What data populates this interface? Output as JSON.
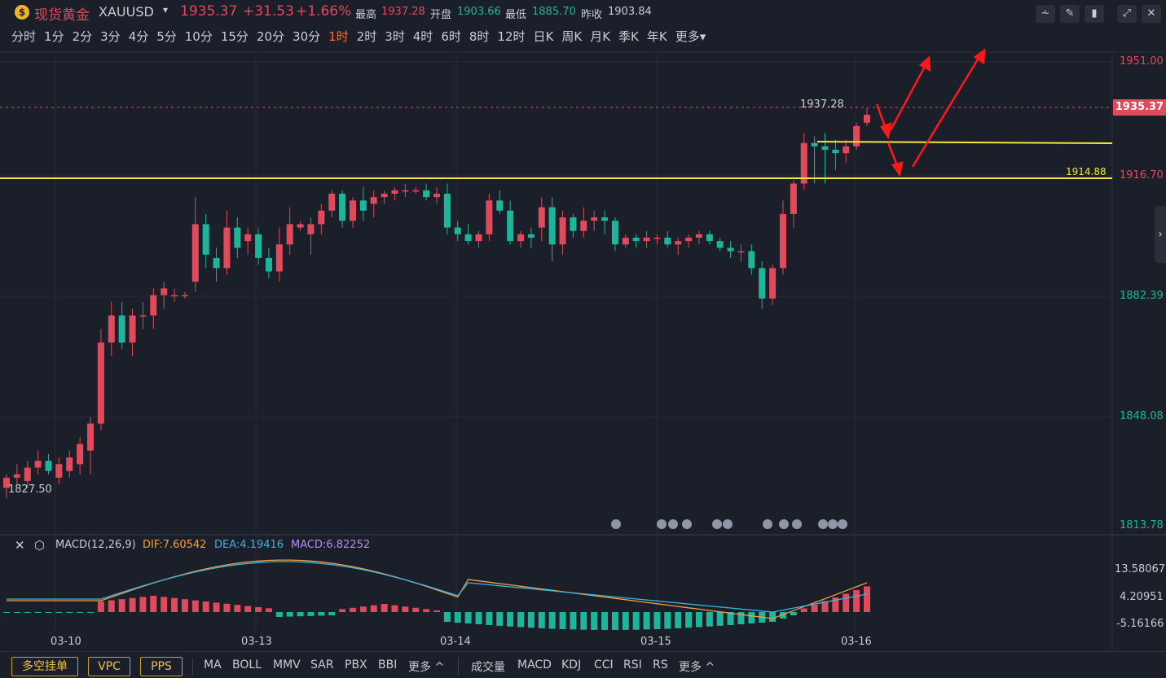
{
  "header": {
    "title": "现货黄金",
    "symbol": "XAUUSD",
    "price": "1935.37",
    "change": "+31.53",
    "change_pct": "+1.66%",
    "high_label": "最高",
    "high": "1937.28",
    "open_label": "开盘",
    "open": "1903.66",
    "low_label": "最低",
    "low": "1885.70",
    "prev_label": "昨收",
    "prev": "1903.84"
  },
  "periods": [
    "分时",
    "1分",
    "2分",
    "3分",
    "4分",
    "5分",
    "10分",
    "15分",
    "20分",
    "30分",
    "1时",
    "2时",
    "3时",
    "4时",
    "6时",
    "8时",
    "12时",
    "日K",
    "周K",
    "月K",
    "季K",
    "年K",
    "更多"
  ],
  "active_period": "1时",
  "colors": {
    "up": "#e04a5a",
    "down": "#1fb59a",
    "bg": "#1b1f2a",
    "line": "#f5e63a",
    "arrow": "#ff1a1a",
    "dif": "#f0a040",
    "dea": "#3ab4e0",
    "macd": "#b98cf0"
  },
  "y_axis": {
    "labels": [
      "1951.00",
      "1916.70",
      "1882.39",
      "1848.08",
      "1813.78"
    ],
    "current_price_tag": "1935.37",
    "line_level_tag": "1914.88"
  },
  "annotations": {
    "high_label": "1937.28",
    "low_label": "1827.50"
  },
  "dates": [
    "03-10",
    "03-13",
    "03-14",
    "03-15",
    "03-16"
  ],
  "macd": {
    "title": "MACD(12,26,9)",
    "dif": "DIF:7.60542",
    "dea": "DEA:4.19416",
    "macd": "MACD:6.82252",
    "labels": [
      "13.58067",
      "4.20951",
      "-5.16166"
    ]
  },
  "bottom": {
    "buttons": [
      "多空挂单",
      "VPC",
      "PPS"
    ],
    "indicators": [
      "MA",
      "BOLL",
      "MMV",
      "SAR",
      "PBX",
      "BBI",
      "更多 ^"
    ],
    "sub_indicators": [
      "成交量",
      "MACD",
      "KDJ",
      "CCI",
      "RSI",
      "RS",
      "更多 ^"
    ]
  },
  "chart_data": {
    "type": "candlestick",
    "series": [
      {
        "o": 1825,
        "h": 1829,
        "l": 1822,
        "c": 1828
      },
      {
        "o": 1828,
        "h": 1832,
        "l": 1826,
        "c": 1829
      },
      {
        "o": 1827,
        "h": 1833,
        "l": 1825,
        "c": 1831
      },
      {
        "o": 1831,
        "h": 1836,
        "l": 1829,
        "c": 1833
      },
      {
        "o": 1833,
        "h": 1835,
        "l": 1829,
        "c": 1830
      },
      {
        "o": 1828,
        "h": 1834,
        "l": 1826,
        "c": 1832
      },
      {
        "o": 1830,
        "h": 1836,
        "l": 1828,
        "c": 1834
      },
      {
        "o": 1832,
        "h": 1840,
        "l": 1829,
        "c": 1838
      },
      {
        "o": 1836,
        "h": 1846,
        "l": 1829,
        "c": 1844
      },
      {
        "o": 1844,
        "h": 1872,
        "l": 1842,
        "c": 1868
      },
      {
        "o": 1868,
        "h": 1880,
        "l": 1864,
        "c": 1876
      },
      {
        "o": 1876,
        "h": 1880,
        "l": 1866,
        "c": 1868
      },
      {
        "o": 1868,
        "h": 1878,
        "l": 1864,
        "c": 1876
      },
      {
        "o": 1876,
        "h": 1880,
        "l": 1872,
        "c": 1876
      },
      {
        "o": 1876,
        "h": 1884,
        "l": 1872,
        "c": 1882
      },
      {
        "o": 1882,
        "h": 1886,
        "l": 1878,
        "c": 1884
      },
      {
        "o": 1882,
        "h": 1884,
        "l": 1880,
        "c": 1882
      },
      {
        "o": 1882,
        "h": 1883,
        "l": 1881,
        "c": 1882
      },
      {
        "o": 1886,
        "h": 1911,
        "l": 1883,
        "c": 1903
      },
      {
        "o": 1903,
        "h": 1906,
        "l": 1890,
        "c": 1894
      },
      {
        "o": 1893,
        "h": 1896,
        "l": 1886,
        "c": 1890
      },
      {
        "o": 1890,
        "h": 1907,
        "l": 1888,
        "c": 1902
      },
      {
        "o": 1902,
        "h": 1905,
        "l": 1893,
        "c": 1896
      },
      {
        "o": 1898,
        "h": 1902,
        "l": 1894,
        "c": 1900
      },
      {
        "o": 1900,
        "h": 1902,
        "l": 1891,
        "c": 1893
      },
      {
        "o": 1893,
        "h": 1896,
        "l": 1887,
        "c": 1889
      },
      {
        "o": 1889,
        "h": 1902,
        "l": 1886,
        "c": 1897
      },
      {
        "o": 1897,
        "h": 1908,
        "l": 1894,
        "c": 1903
      },
      {
        "o": 1902,
        "h": 1904,
        "l": 1901,
        "c": 1903
      },
      {
        "o": 1900,
        "h": 1905,
        "l": 1894,
        "c": 1903
      },
      {
        "o": 1903,
        "h": 1909,
        "l": 1900,
        "c": 1907
      },
      {
        "o": 1907,
        "h": 1913,
        "l": 1905,
        "c": 1912
      },
      {
        "o": 1912,
        "h": 1913,
        "l": 1902,
        "c": 1904
      },
      {
        "o": 1904,
        "h": 1911,
        "l": 1902,
        "c": 1910
      },
      {
        "o": 1910,
        "h": 1914,
        "l": 1904,
        "c": 1907
      },
      {
        "o": 1909,
        "h": 1913,
        "l": 1905,
        "c": 1911
      },
      {
        "o": 1911,
        "h": 1913,
        "l": 1909,
        "c": 1912
      },
      {
        "o": 1912,
        "h": 1914,
        "l": 1910,
        "c": 1913
      },
      {
        "o": 1913,
        "h": 1915,
        "l": 1911,
        "c": 1913
      },
      {
        "o": 1913,
        "h": 1914,
        "l": 1912,
        "c": 1913
      },
      {
        "o": 1913,
        "h": 1915,
        "l": 1910,
        "c": 1911
      },
      {
        "o": 1911,
        "h": 1914,
        "l": 1909,
        "c": 1912
      },
      {
        "o": 1912,
        "h": 1915,
        "l": 1900,
        "c": 1902
      },
      {
        "o": 1902,
        "h": 1904,
        "l": 1898,
        "c": 1900
      },
      {
        "o": 1900,
        "h": 1903,
        "l": 1897,
        "c": 1898
      },
      {
        "o": 1898,
        "h": 1901,
        "l": 1896,
        "c": 1900
      },
      {
        "o": 1900,
        "h": 1912,
        "l": 1898,
        "c": 1910
      },
      {
        "o": 1910,
        "h": 1913,
        "l": 1906,
        "c": 1907
      },
      {
        "o": 1907,
        "h": 1910,
        "l": 1897,
        "c": 1898
      },
      {
        "o": 1898,
        "h": 1901,
        "l": 1896,
        "c": 1900
      },
      {
        "o": 1900,
        "h": 1902,
        "l": 1896,
        "c": 1899
      },
      {
        "o": 1902,
        "h": 1911,
        "l": 1898,
        "c": 1908
      },
      {
        "o": 1908,
        "h": 1911,
        "l": 1892,
        "c": 1897
      },
      {
        "o": 1897,
        "h": 1907,
        "l": 1894,
        "c": 1905
      },
      {
        "o": 1905,
        "h": 1906,
        "l": 1899,
        "c": 1901
      },
      {
        "o": 1901,
        "h": 1908,
        "l": 1899,
        "c": 1904
      },
      {
        "o": 1904,
        "h": 1907,
        "l": 1901,
        "c": 1905
      },
      {
        "o": 1905,
        "h": 1907,
        "l": 1900,
        "c": 1904
      },
      {
        "o": 1904,
        "h": 1905,
        "l": 1895,
        "c": 1897
      },
      {
        "o": 1897,
        "h": 1900,
        "l": 1896,
        "c": 1899
      },
      {
        "o": 1899,
        "h": 1900,
        "l": 1896,
        "c": 1898
      },
      {
        "o": 1898,
        "h": 1901,
        "l": 1896,
        "c": 1899
      },
      {
        "o": 1899,
        "h": 1900,
        "l": 1897,
        "c": 1899
      },
      {
        "o": 1899,
        "h": 1901,
        "l": 1896,
        "c": 1897
      },
      {
        "o": 1897,
        "h": 1899,
        "l": 1894,
        "c": 1898
      },
      {
        "o": 1898,
        "h": 1900,
        "l": 1896,
        "c": 1899
      },
      {
        "o": 1899,
        "h": 1901,
        "l": 1897,
        "c": 1900
      },
      {
        "o": 1900,
        "h": 1901,
        "l": 1897,
        "c": 1898
      },
      {
        "o": 1898,
        "h": 1899,
        "l": 1895,
        "c": 1896
      },
      {
        "o": 1896,
        "h": 1898,
        "l": 1893,
        "c": 1895
      },
      {
        "o": 1895,
        "h": 1897,
        "l": 1892,
        "c": 1895
      },
      {
        "o": 1895,
        "h": 1897,
        "l": 1888,
        "c": 1890
      },
      {
        "o": 1890,
        "h": 1892,
        "l": 1878,
        "c": 1881
      },
      {
        "o": 1881,
        "h": 1891,
        "l": 1879,
        "c": 1890
      },
      {
        "o": 1890,
        "h": 1910,
        "l": 1888,
        "c": 1906
      },
      {
        "o": 1906,
        "h": 1916,
        "l": 1902,
        "c": 1915
      },
      {
        "o": 1915,
        "h": 1930,
        "l": 1913,
        "c": 1927
      },
      {
        "o": 1927,
        "h": 1929,
        "l": 1915,
        "c": 1926
      },
      {
        "o": 1926,
        "h": 1930,
        "l": 1915,
        "c": 1925
      },
      {
        "o": 1925,
        "h": 1928,
        "l": 1919,
        "c": 1924
      },
      {
        "o": 1924,
        "h": 1928,
        "l": 1921,
        "c": 1926
      },
      {
        "o": 1926,
        "h": 1933,
        "l": 1925,
        "c": 1932
      },
      {
        "o": 1933,
        "h": 1937.28,
        "l": 1932,
        "c": 1935.37
      }
    ],
    "ylim": [
      1813.78,
      1951.0
    ]
  }
}
